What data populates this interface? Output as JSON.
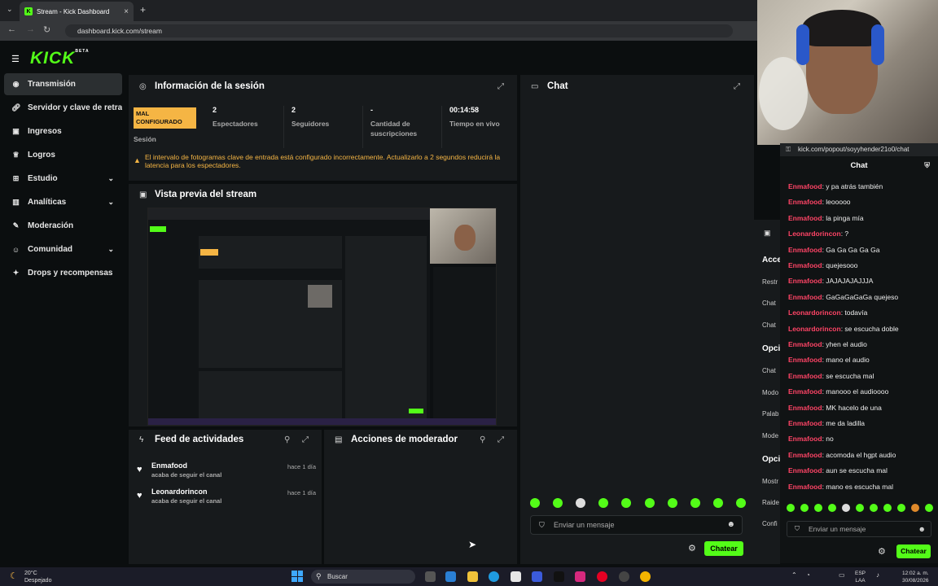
{
  "browser": {
    "tab_title": "Stream - Kick Dashboard",
    "url": "dashboard.kick.com/stream",
    "tab_close": "×",
    "new_tab": "+"
  },
  "sidebar": {
    "logo": "KICK",
    "logo_beta": "BETA",
    "items": [
      {
        "label": "Transmisión",
        "icon": "broadcast-icon"
      },
      {
        "label": "Servidor y clave de retransmisión",
        "icon": "link-icon"
      },
      {
        "label": "Ingresos",
        "icon": "money-icon"
      },
      {
        "label": "Logros",
        "icon": "trophy-icon"
      },
      {
        "label": "Estudio",
        "icon": "studio-icon"
      },
      {
        "label": "Analíticas",
        "icon": "chart-icon"
      },
      {
        "label": "Moderación",
        "icon": "wrench-icon"
      },
      {
        "label": "Comunidad",
        "icon": "community-icon"
      },
      {
        "label": "Drops y recompensas",
        "icon": "gift-icon"
      }
    ]
  },
  "session": {
    "title": "Información de la sesión",
    "badge": "MAL CONFIGURADO",
    "session_label": "Sesión",
    "stats": [
      {
        "value": "2",
        "label": "Espectadores"
      },
      {
        "value": "2",
        "label": "Seguidores"
      },
      {
        "value": "-",
        "label": "Cantidad de suscripciones"
      },
      {
        "value": "00:14:58",
        "label": "Tiempo en vivo"
      }
    ],
    "warning": "El intervalo de fotogramas clave de entrada está configurado incorrectamente. Actualizarlo a 2 segundos reducirá la latencia para los espectadores."
  },
  "preview": {
    "title": "Vista previa del stream"
  },
  "activity": {
    "title": "Feed de actividades",
    "items": [
      {
        "name": "Enmafood",
        "sub": "acaba de seguir el canal",
        "time": "hace 1 día"
      },
      {
        "name": "Leonardorincon",
        "sub": "acaba de seguir el canal",
        "time": "hace 1 día"
      }
    ]
  },
  "moderator": {
    "title": "Acciones de moderador"
  },
  "chat": {
    "title": "Chat",
    "placeholder": "Enviar un mensaje",
    "send": "Chatear"
  },
  "popout": {
    "url": "kick.com/popout/soyyhender21o0/chat",
    "title": "Chat",
    "placeholder": "Enviar un mensaje",
    "send": "Chatear",
    "messages": [
      {
        "user": "Enmafood",
        "text": ": y pa atrás también"
      },
      {
        "user": "Enmafood",
        "text": ": leooooo"
      },
      {
        "user": "Enmafood",
        "text": ": la pinga mía"
      },
      {
        "user": "Leonardorincon",
        "text": ": ?"
      },
      {
        "user": "Enmafood",
        "text": ": Ga Ga Ga Ga Ga"
      },
      {
        "user": "Enmafood",
        "text": ": quejesooo"
      },
      {
        "user": "Enmafood",
        "text": ": JAJAJAJAJJJA"
      },
      {
        "user": "Enmafood",
        "text": ": GaGaGaGaGa quejeso"
      },
      {
        "user": "Leonardorincon",
        "text": ": todavía"
      },
      {
        "user": "Leonardorincon",
        "text": ": se escucha doble"
      },
      {
        "user": "Enmafood",
        "text": ": yhen el audio"
      },
      {
        "user": "Enmafood",
        "text": ": mano el audio"
      },
      {
        "user": "Enmafood",
        "text": ": se escucha mal"
      },
      {
        "user": "Enmafood",
        "text": ": manooo el audioooo"
      },
      {
        "user": "Enmafood",
        "text": ": MK hacelo de una"
      },
      {
        "user": "Enmafood",
        "text": ": me da ladilla"
      },
      {
        "user": "Enmafood",
        "text": ": no"
      },
      {
        "user": "Enmafood",
        "text": ": acomoda el hgpt audio"
      },
      {
        "user": "Enmafood",
        "text": ": aun se escucha mal"
      },
      {
        "user": "Enmafood",
        "text": ": mano es escucha mal"
      }
    ]
  },
  "behind_panel": {
    "labels": [
      "Acce",
      "Restr",
      "Chat",
      "Chat",
      "Opci",
      "Chat",
      "Modo",
      "Palab",
      "Mode",
      "Opci",
      "Mostr",
      "Raide",
      "Confi"
    ]
  },
  "taskbar": {
    "temp": "20°C",
    "weather": "Despejado",
    "search": "Buscar",
    "lang1": "ESP",
    "lang2": "LAA",
    "time": "12:02 a. m.",
    "date": "30/08/2026"
  },
  "colors": {
    "accent": "#53fc18",
    "warning": "#f5b544",
    "username": "#ff4466"
  }
}
